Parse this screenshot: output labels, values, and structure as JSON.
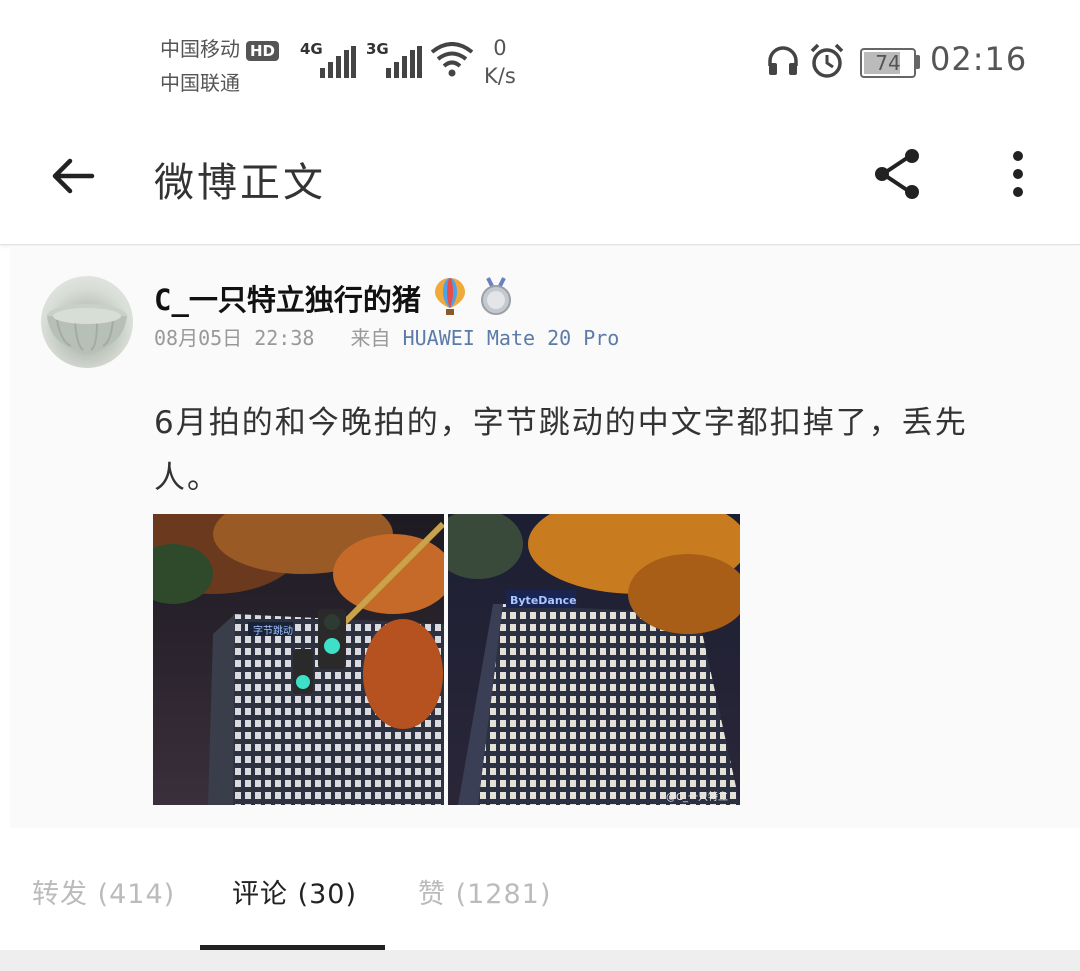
{
  "status_bar": {
    "carrier1": "中国移动",
    "hd": "HD",
    "carrier2": "中国联通",
    "signal1": "4G",
    "signal2": "3G",
    "speed_value": "0",
    "speed_unit": "K/s",
    "battery": "74",
    "battery_level": 0.74,
    "time": "02:16"
  },
  "toolbar": {
    "title": "微博正文",
    "back_icon": "arrow-left-icon",
    "share_icon": "share-icon",
    "more_icon": "more-vertical-icon"
  },
  "post": {
    "username": "C_一只特立独行的猪",
    "date": "08月05日 22:38",
    "from_label": "来自",
    "device": "HUAWEI Mate 20 Pro",
    "text": "6月拍的和今晚拍的，字节跳动的中文字都扣掉了，丢先人。",
    "photo1_sign": "字节跳动",
    "photo2_sign": "ByteDance",
    "watermark": "@C_一只特立"
  },
  "tabs": [
    {
      "label": "转发 (414)"
    },
    {
      "label": "评论 (30)"
    },
    {
      "label": "赞 (1281)"
    }
  ],
  "colors": {
    "link": "#5b7ca8",
    "active_tab": "#222222",
    "inactive_tab": "#bbbbbb"
  }
}
